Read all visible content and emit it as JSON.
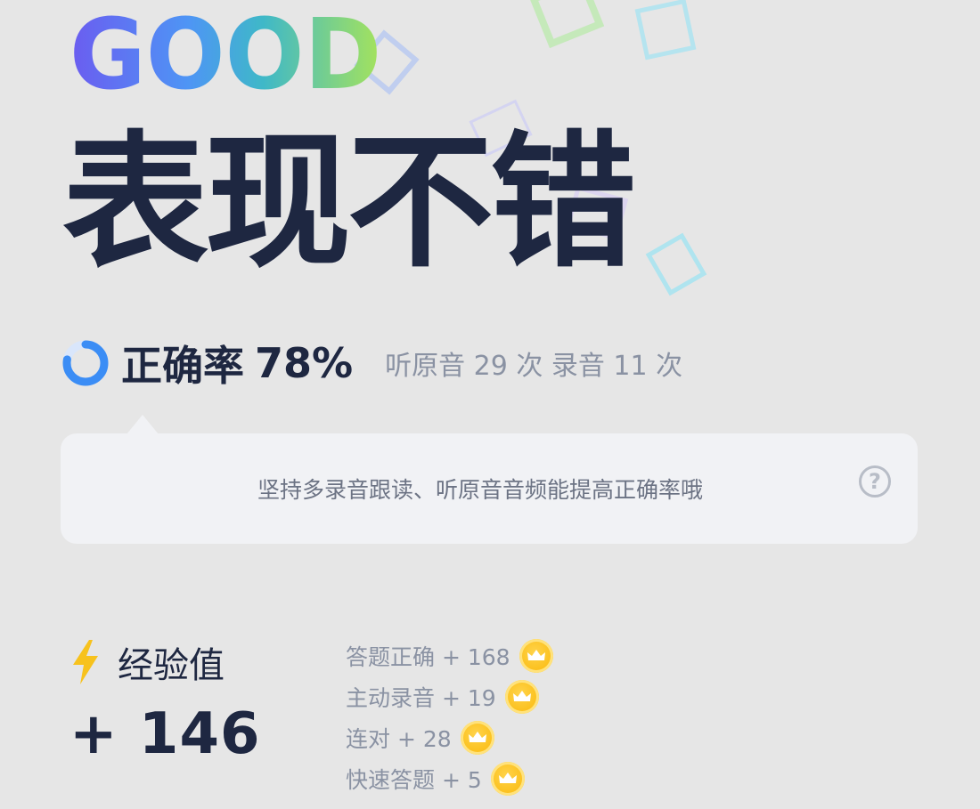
{
  "header": {
    "good": "GOOD",
    "title": "表现不错"
  },
  "accuracy": {
    "label": "正确率",
    "value": "78%",
    "percent": 78,
    "stats": "听原音 29 次 录音 11 次"
  },
  "tip": {
    "text": "坚持多录音跟读、听原音音频能提高正确率哦",
    "help_symbol": "?"
  },
  "experience": {
    "label": "经验值",
    "total": "+ 146",
    "items": [
      {
        "label": "答题正确 + 168"
      },
      {
        "label": "主动录音 + 19"
      },
      {
        "label": "连对 + 28"
      },
      {
        "label": "快速答题 + 5"
      }
    ]
  },
  "icons": {
    "ring": "accuracy-ring-icon",
    "help": "question-circle-icon",
    "bolt": "lightning-bolt-icon",
    "coin": "crown-coin-icon"
  },
  "colors": {
    "background": "#e6e6e6",
    "title": "#1e2741",
    "muted": "#8a92a3",
    "accent": "#3b8df5",
    "coin": "#fbbf1a",
    "bolt": "#f7c21d"
  }
}
